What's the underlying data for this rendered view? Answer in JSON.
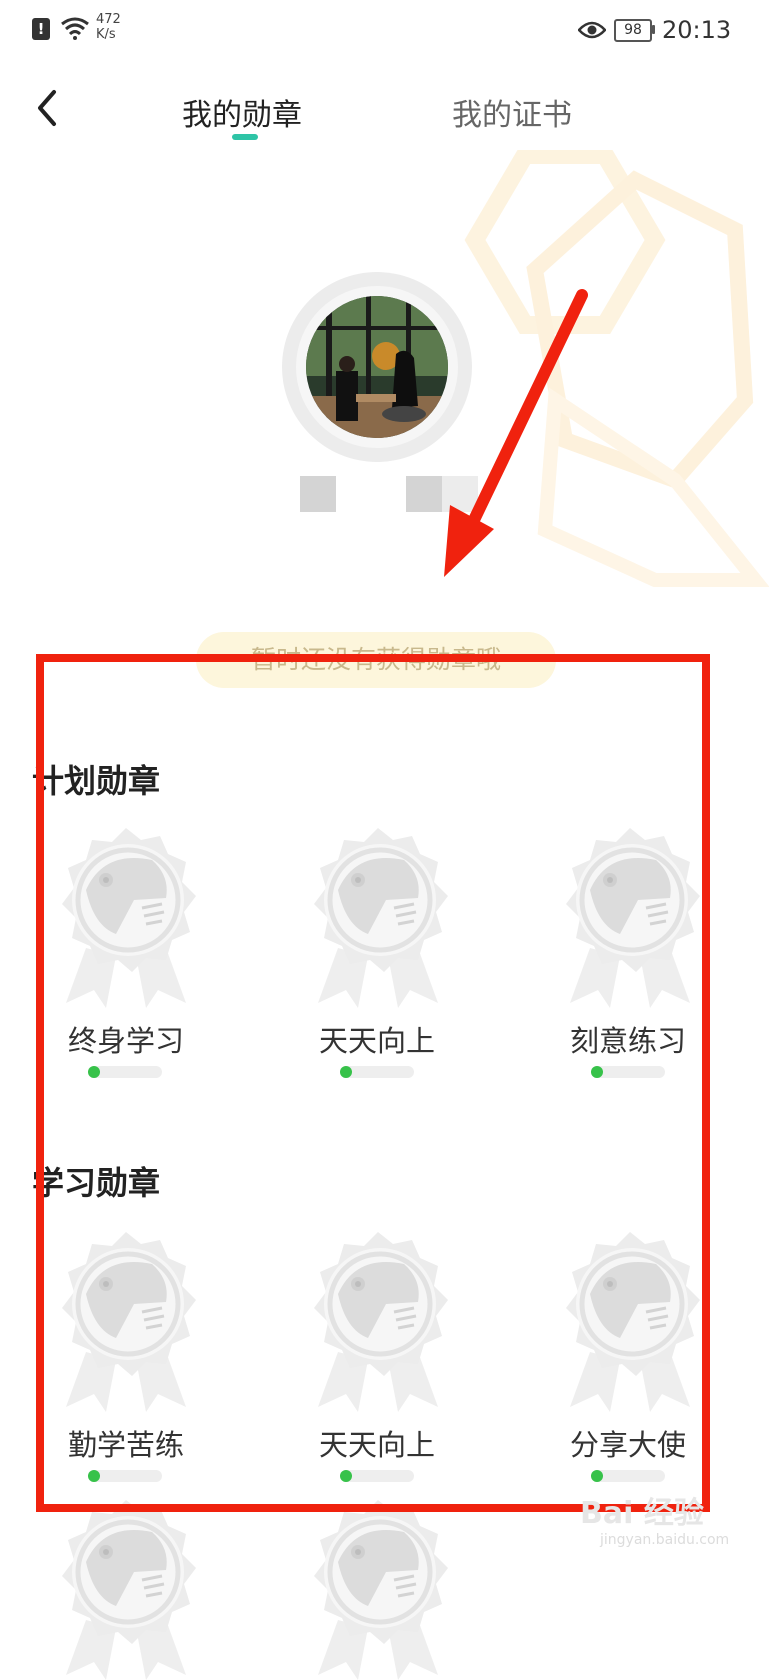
{
  "status_bar": {
    "speed_value": "472",
    "speed_unit": "K/s",
    "battery": "98",
    "time": "20:13",
    "icons": [
      "alert-icon",
      "wifi-icon",
      "eye-icon",
      "battery-icon"
    ]
  },
  "nav": {
    "tabs": [
      {
        "label": "我的勋章",
        "active": true
      },
      {
        "label": "我的证书",
        "active": false
      }
    ],
    "accent_color": "#2ec4a6"
  },
  "notice": "暂时还没有获得勋章哦",
  "sections": [
    {
      "title": "计划勋章",
      "badges": [
        {
          "name": "终身学习",
          "progress": 0
        },
        {
          "name": "天天向上",
          "progress": 0
        },
        {
          "name": "刻意练习",
          "progress": 0
        }
      ]
    },
    {
      "title": "学习勋章",
      "badges": [
        {
          "name": "勤学苦练",
          "progress": 0
        },
        {
          "name": "天天向上",
          "progress": 0
        },
        {
          "name": "分享大使",
          "progress": 0
        }
      ]
    }
  ],
  "watermark": {
    "brand": "Bai 经验",
    "url": "jingyan.baidu.com"
  },
  "colors": {
    "annotation_red": "#f0220e",
    "progress_green": "#37c24a"
  }
}
